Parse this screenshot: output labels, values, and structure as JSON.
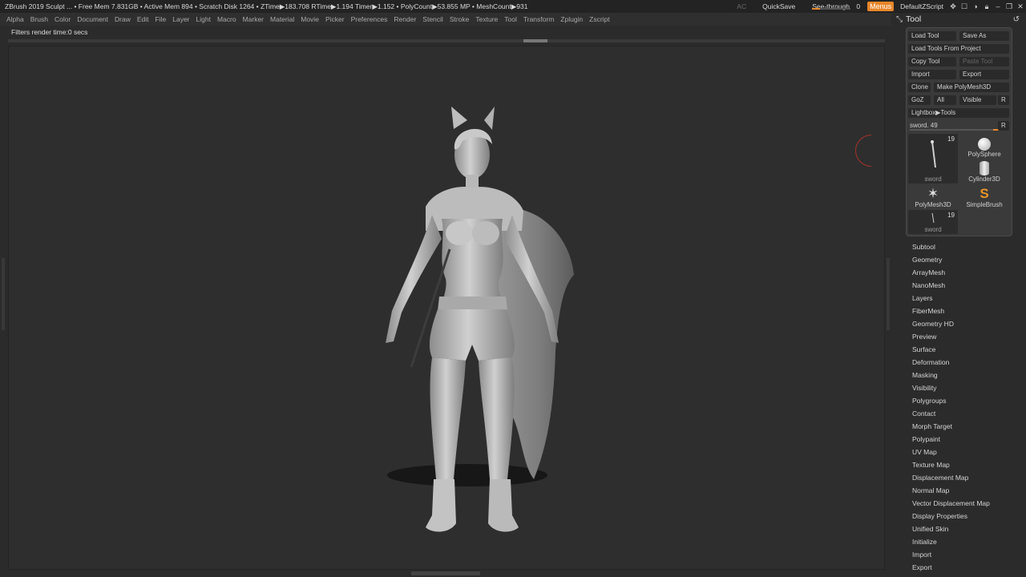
{
  "titlebar": {
    "stats": "ZBrush 2019   Sculpt   ...  • Free Mem 7.831GB • Active Mem 894 • Scratch Disk 1264 •  ZTime▶183.708 RTime▶1.194 Timer▶1.152 • PolyCount▶53.855 MP  • MeshCount▶931",
    "ac": "AC",
    "quicksave": "QuickSave",
    "see_through_label": "See-through",
    "see_through_value": "0",
    "menus": "Menus",
    "script": "DefaultZScript"
  },
  "menubar": [
    "Alpha",
    "Brush",
    "Color",
    "Document",
    "Draw",
    "Edit",
    "File",
    "Layer",
    "Light",
    "Macro",
    "Marker",
    "Material",
    "Movie",
    "Picker",
    "Preferences",
    "Render",
    "Stencil",
    "Stroke",
    "Texture",
    "Tool",
    "Transform",
    "Zplugin",
    "Zscript"
  ],
  "status": "Filters render time:0 secs",
  "tool_palette": {
    "title": "Tool",
    "load_tool": "Load Tool",
    "save_as": "Save As",
    "load_from_project": "Load Tools From Project",
    "copy_tool": "Copy Tool",
    "paste_tool": "Paste Tool",
    "import": "Import",
    "export": "Export",
    "clone": "Clone",
    "make_polymesh": "Make PolyMesh3D",
    "goz": "GoZ",
    "all": "All",
    "visible": "Visible",
    "r": "R",
    "lightbox": "Lightbox▶Tools",
    "slider_label": "sword. 49",
    "current_tool": {
      "name": "sword",
      "count": "19"
    },
    "small_tool": {
      "name": "sword",
      "count": "19"
    },
    "polysphere": "PolySphere",
    "cylinder": "Cylinder3D",
    "polymesh": "PolyMesh3D",
    "simplebrush": "SimpleBrush"
  },
  "subpalettes": [
    "Subtool",
    "Geometry",
    "ArrayMesh",
    "NanoMesh",
    "Layers",
    "FiberMesh",
    "Geometry HD",
    "Preview",
    "Surface",
    "Deformation",
    "Masking",
    "Visibility",
    "Polygroups",
    "Contact",
    "Morph Target",
    "Polypaint",
    "UV Map",
    "Texture Map",
    "Displacement Map",
    "Normal Map",
    "Vector Displacement Map",
    "Display Properties",
    "Unified Skin",
    "Initialize",
    "Import",
    "Export"
  ],
  "colors": {
    "accent": "#e8862a",
    "canvas": "#2e2e2e",
    "model": "#bdbdbd"
  }
}
